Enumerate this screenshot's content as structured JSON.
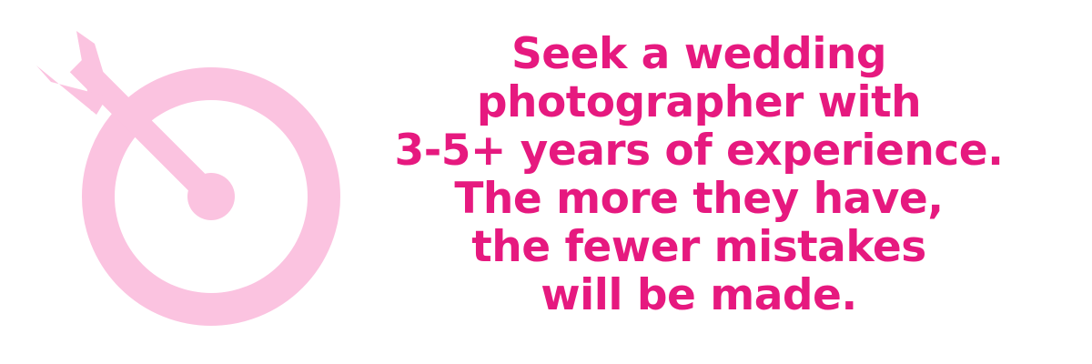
{
  "graphic": {
    "icon": "target-with-arrow-icon",
    "icon_color": "#fbc3e0"
  },
  "message": {
    "text_color": "#e6197f",
    "lines": [
      "Seek a wedding",
      "photographer with",
      "3-5+ years of experience.",
      "The more they have,",
      "the fewer mistakes",
      "will be made."
    ]
  }
}
